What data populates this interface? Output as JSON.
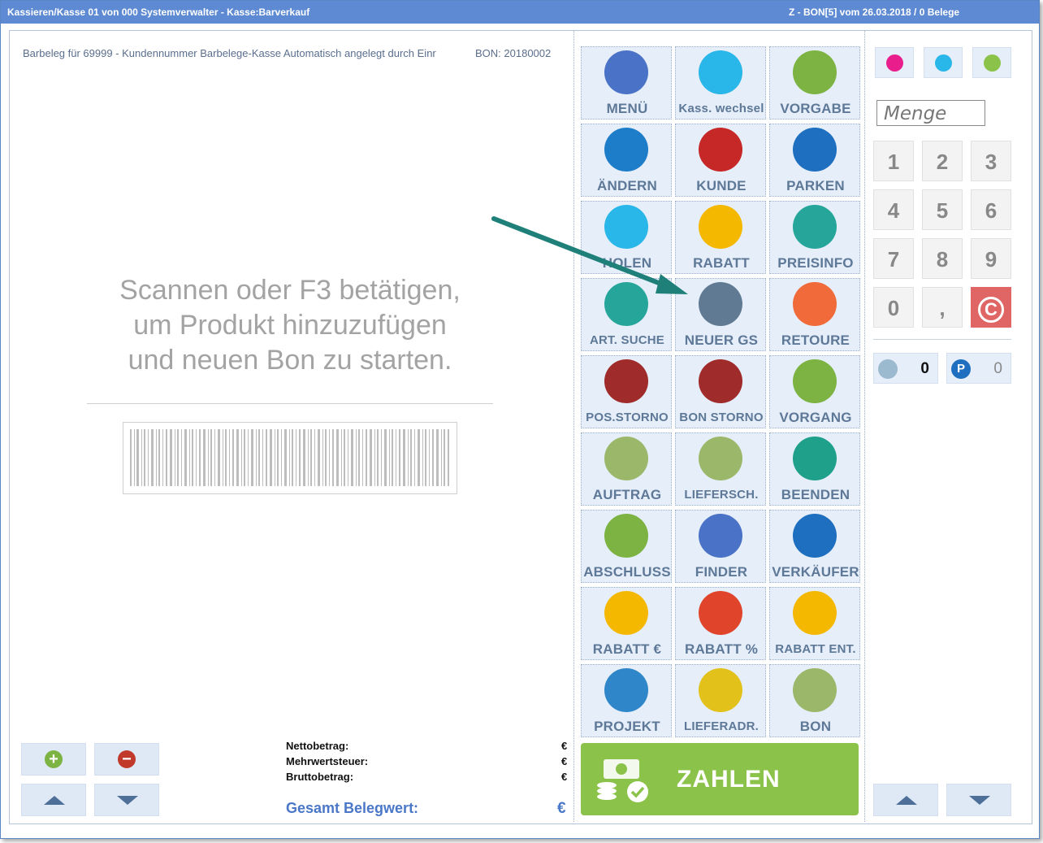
{
  "window": {
    "title_left": "Kassieren/Kasse 01 von 000 Systemverwalter - Kasse:Barverkauf",
    "title_right": "Z - BON[5] vom 26.03.2018 / 0 Belege"
  },
  "receipt": {
    "header": "Barbeleg für 69999 - Kundennummer Barbelege-Kasse Automatisch angelegt durch Einr",
    "bon": "BON: 20180002",
    "hint_lines": [
      "Scannen oder F3 betätigen,",
      "um Produkt hinzuzufügen",
      "und neuen Bon zu starten."
    ]
  },
  "totals": {
    "netto_label": "Nettobetrag:",
    "mwst_label": "Mehrwertsteuer:",
    "brutto_label": "Bruttobetrag:",
    "currency": "€",
    "gesamt_label": "Gesamt Belegwert:"
  },
  "tiles": [
    {
      "label": "MENÜ",
      "icon": "menu-icon",
      "color": "#4a72c6"
    },
    {
      "label": "Kass. wechsel",
      "icon": "user-switch-icon",
      "color": "#29b6e8"
    },
    {
      "label": "VORGABE",
      "icon": "settings-check-icon",
      "color": "#7cb342"
    },
    {
      "label": "ÄNDERN",
      "icon": "pencil-icon",
      "color": "#1e7dc8"
    },
    {
      "label": "KUNDE",
      "icon": "customer-icon",
      "color": "#c62828"
    },
    {
      "label": "PARKEN",
      "icon": "parking-icon",
      "color": "#1e6fbf"
    },
    {
      "label": "HOLEN",
      "icon": "receipt-fetch-icon",
      "color": "#29b6e8"
    },
    {
      "label": "RABATT",
      "icon": "money-icon",
      "color": "#f5b800"
    },
    {
      "label": "PREISINFO",
      "icon": "price-bag-icon",
      "color": "#26a69a"
    },
    {
      "label": "ART. SUCHE",
      "icon": "bag-search-icon",
      "color": "#26a69a"
    },
    {
      "label": "NEUER GS",
      "icon": "voucher-add-icon",
      "color": "#5f7a92"
    },
    {
      "label": "RETOURE",
      "icon": "return-icon",
      "color": "#f06a3a"
    },
    {
      "label": "POS.STORNO",
      "icon": "trash-icon",
      "color": "#a02b2b"
    },
    {
      "label": "BON STORNO",
      "icon": "trash-receipt-icon",
      "color": "#a02b2b"
    },
    {
      "label": "VORGANG",
      "icon": "document-icon",
      "color": "#7cb342"
    },
    {
      "label": "AUFTRAG",
      "icon": "document-a-icon",
      "color": "#9bb86a"
    },
    {
      "label": "LIEFERSCH.",
      "icon": "document-l-icon",
      "color": "#9bb86a"
    },
    {
      "label": "BEENDEN",
      "icon": "power-icon",
      "color": "#1fa08a"
    },
    {
      "label": "ABSCHLUSS",
      "icon": "register-check-icon",
      "color": "#7cb342"
    },
    {
      "label": "FINDER",
      "icon": "finder-icon",
      "color": "#4a72c6"
    },
    {
      "label": "VERKÄUFER",
      "icon": "seller-icon",
      "color": "#1e6fbf"
    },
    {
      "label": "RABATT €",
      "icon": "money-euro-icon",
      "color": "#f5b800"
    },
    {
      "label": "RABATT %",
      "icon": "money-percent-icon",
      "color": "#e0442b"
    },
    {
      "label": "RABATT ENT.",
      "icon": "money-remove-icon",
      "color": "#f5b800"
    },
    {
      "label": "PROJEKT",
      "icon": "binder-icon",
      "color": "#2f86c9"
    },
    {
      "label": "LIEFERADR.",
      "icon": "truck-icon",
      "color": "#e2c21a"
    },
    {
      "label": "BON",
      "icon": "document-b-icon",
      "color": "#9bb86a"
    }
  ],
  "pay": {
    "label": "ZAHLEN",
    "color": "#8bc34a"
  },
  "right": {
    "menge_placeholder": "Menge",
    "keys": [
      "1",
      "2",
      "3",
      "4",
      "5",
      "6",
      "7",
      "8",
      "9",
      "0",
      ",",
      "C"
    ],
    "counter_receipts": "0",
    "counter_parked": "0",
    "counter_parked_icon_label": "P"
  },
  "nav": {
    "plus": "+",
    "minus": "−"
  }
}
